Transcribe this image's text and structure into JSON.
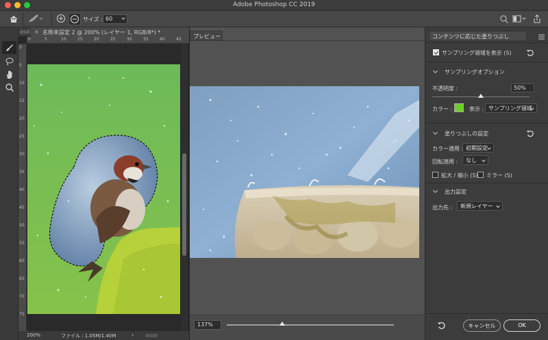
{
  "window": {
    "title": "Adobe Photoshop CC 2019"
  },
  "options_bar": {
    "size_label": "サイズ :",
    "size_value": "60"
  },
  "tools": [
    "brush-tool",
    "lasso-tool",
    "hand-tool",
    "zoom-tool"
  ],
  "document": {
    "prev_tab_label": "osd",
    "tab_label": "名称未設定 2 @ 200% (レイヤー 1, RGB/8*) *",
    "zoom": "200%",
    "file_info": "ファイル : 1.05M/1.40M",
    "ruler_top": [
      "0",
      "5",
      "10",
      "15",
      "20",
      "25",
      "30",
      "35",
      "40",
      "45"
    ],
    "ruler_left": [
      "0",
      "5",
      "10",
      "15",
      "20",
      "25",
      "30",
      "35",
      "40",
      "45",
      "50",
      "55",
      "60",
      "65",
      "70",
      "75"
    ]
  },
  "preview": {
    "tab_label": "プレビュー",
    "zoom_value": "137%",
    "zoom_fraction": 0.33
  },
  "panel": {
    "tab_label": "コンテンツに応じた塗りつぶし",
    "show_sampling_label": "サンプリング領域を表示 (S)",
    "show_sampling_checked": true,
    "sampling_options_title": "サンプリングオプション",
    "opacity_label": "不透明度 :",
    "opacity_value": "50%",
    "opacity_fraction": 0.5,
    "color_label": "カラー :",
    "sampling_color": "#6fcf2a",
    "display_label": "表示 :",
    "display_value": "サンプリング領域",
    "fill_settings_title": "塗りつぶしの設定",
    "color_adapt_label": "カラー適用 :",
    "color_adapt_value": "初期設定",
    "rotation_label": "回転適用 :",
    "rotation_value": "なし",
    "scale_label": "拡大 / 縮小 (S)",
    "mirror_label": "ミラー (S)",
    "output_title": "出力設定",
    "output_label": "出力先 :",
    "output_value": "新規レイヤー",
    "cancel_label": "キャンセル",
    "ok_label": "OK"
  },
  "colors": {
    "accent_green": "#6fcf2a"
  }
}
